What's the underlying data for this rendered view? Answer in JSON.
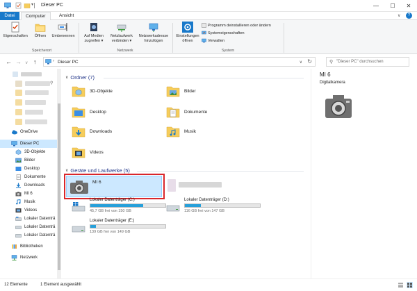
{
  "window": {
    "title": "Dieser PC",
    "minimize_glyph": "—",
    "maximize_glyph": "☐",
    "close_glyph": "✕"
  },
  "tabs": [
    {
      "label": "Datei"
    },
    {
      "label": "Computer"
    },
    {
      "label": "Ansicht"
    }
  ],
  "ribbon": {
    "location_items": [
      {
        "label_1": "Eigenschaften",
        "label_2": ""
      },
      {
        "label_1": "Öffnen",
        "label_2": ""
      },
      {
        "label_1": "Umbenennen",
        "label_2": ""
      }
    ],
    "location_group": "Speicherort",
    "network_items": [
      {
        "label_1": "Auf Medien",
        "label_2": "zugreifen ▾"
      },
      {
        "label_1": "Netzlaufwerk",
        "label_2": "verbinden ▾"
      },
      {
        "label_1": "Netzwerkadresse",
        "label_2": "hinzufügen"
      }
    ],
    "network_group": "Netzwerk",
    "settings_item": {
      "label_1": "Einstellungen",
      "label_2": "öffnen"
    },
    "system_links": [
      {
        "label": "Programm deinstallieren oder ändern"
      },
      {
        "label": "Systemeigenschaften"
      },
      {
        "label": "Verwalten"
      }
    ],
    "system_group": "System"
  },
  "navbar": {
    "back": "←",
    "forward": "→",
    "recent": "∨",
    "up": "↑",
    "address": "Dieser PC",
    "address_chevron": "›",
    "dropdown": "∨",
    "refresh": "↻",
    "search_icon": "⚲",
    "search_placeholder": "\"Dieser PC\" durchsuchen"
  },
  "sidebar": {
    "items": [
      {
        "label": "OneDrive",
        "icon": "cloud-icon"
      },
      {
        "label": "Dieser PC",
        "icon": "computer-icon"
      },
      {
        "label": "3D-Objekte",
        "icon": "cube-icon"
      },
      {
        "label": "Bilder",
        "icon": "pictures-icon"
      },
      {
        "label": "Desktop",
        "icon": "desktop-icon"
      },
      {
        "label": "Dokumente",
        "icon": "document-icon"
      },
      {
        "label": "Downloads",
        "icon": "download-icon"
      },
      {
        "label": "MI 6",
        "icon": "camera-icon"
      },
      {
        "label": "Musik",
        "icon": "music-icon"
      },
      {
        "label": "Videos",
        "icon": "video-icon"
      },
      {
        "label": "Lokaler Datenträ",
        "icon": "drive-icon"
      },
      {
        "label": "Lokaler Datenträ",
        "icon": "drive-icon"
      },
      {
        "label": "Lokaler Datenträ",
        "icon": "drive-icon"
      },
      {
        "label": "Bibliotheken",
        "icon": "library-icon"
      },
      {
        "label": "Netzwerk",
        "icon": "network-icon"
      }
    ]
  },
  "main": {
    "folders_header": "Ordner (7)",
    "folders": [
      {
        "label": "3D-Objekte"
      },
      {
        "label": "Bilder"
      },
      {
        "label": "Desktop"
      },
      {
        "label": "Dokumente"
      },
      {
        "label": "Downloads"
      },
      {
        "label": "Musik"
      },
      {
        "label": "Videos"
      }
    ],
    "devices_header": "Geräte und Laufwerke (5)",
    "device_selected": "MI 6",
    "drives": [
      {
        "name": "Lokaler Datenträger (C:)",
        "free": "45,7 GB frei von 150 GB",
        "used_fraction": 0.7
      },
      {
        "name": "Lokaler Datenträger (D:)",
        "free": "116 GB frei von 147 GB",
        "used_fraction": 0.21
      },
      {
        "name": "Lokaler Datenträger (E:)",
        "free": "139 GB frei von 149 GB",
        "used_fraction": 0.07
      }
    ]
  },
  "details": {
    "title": "MI 6",
    "subtitle": "Digitalkamera"
  },
  "status": {
    "count": "12 Elemente",
    "selected": "1 Element ausgewählt"
  },
  "colors": {
    "accent": "#1979ca",
    "selection": "#cce8ff",
    "highlight_box": "#d9262b",
    "drive_bar": "#26a0da"
  }
}
